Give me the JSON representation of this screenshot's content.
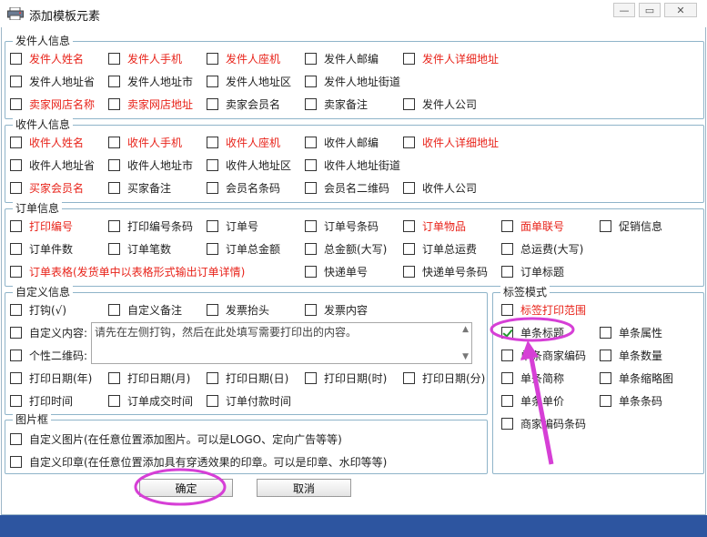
{
  "window": {
    "title": "添加模板元素"
  },
  "sender": {
    "legend": "发件人信息",
    "items": [
      {
        "label": "发件人姓名",
        "red": true
      },
      {
        "label": "发件人手机",
        "red": true
      },
      {
        "label": "发件人座机",
        "red": true
      },
      {
        "label": "发件人邮编",
        "red": false
      },
      {
        "label": "发件人详细地址",
        "red": true
      },
      {
        "label": "发件人地址省",
        "red": false
      },
      {
        "label": "发件人地址市",
        "red": false
      },
      {
        "label": "发件人地址区",
        "red": false
      },
      {
        "label": "发件人地址街道",
        "red": false
      },
      {
        "label": "卖家网店名称",
        "red": true
      },
      {
        "label": "卖家网店地址",
        "red": true
      },
      {
        "label": "卖家会员名",
        "red": false
      },
      {
        "label": "卖家备注",
        "red": false
      },
      {
        "label": "发件人公司",
        "red": false
      }
    ]
  },
  "receiver": {
    "legend": "收件人信息",
    "items": [
      {
        "label": "收件人姓名",
        "red": true
      },
      {
        "label": "收件人手机",
        "red": true
      },
      {
        "label": "收件人座机",
        "red": true
      },
      {
        "label": "收件人邮编",
        "red": false
      },
      {
        "label": "收件人详细地址",
        "red": true
      },
      {
        "label": "收件人地址省",
        "red": false
      },
      {
        "label": "收件人地址市",
        "red": false
      },
      {
        "label": "收件人地址区",
        "red": false
      },
      {
        "label": "收件人地址街道",
        "red": false
      },
      {
        "label": "买家会员名",
        "red": true
      },
      {
        "label": "买家备注",
        "red": false
      },
      {
        "label": "会员名条码",
        "red": false
      },
      {
        "label": "会员名二维码",
        "red": false
      },
      {
        "label": "收件人公司",
        "red": false
      }
    ]
  },
  "order": {
    "legend": "订单信息",
    "items": [
      {
        "label": "打印编号",
        "red": true
      },
      {
        "label": "打印编号条码",
        "red": false
      },
      {
        "label": "订单号",
        "red": false
      },
      {
        "label": "订单号条码",
        "red": false
      },
      {
        "label": "订单物品",
        "red": true
      },
      {
        "label": "面单联号",
        "red": true
      },
      {
        "label": "促销信息",
        "red": false
      },
      {
        "label": "订单件数",
        "red": false
      },
      {
        "label": "订单笔数",
        "red": false
      },
      {
        "label": "订单总金额",
        "red": false
      },
      {
        "label": "总金额(大写)",
        "red": false
      },
      {
        "label": "订单总运费",
        "red": false
      },
      {
        "label": "总运费(大写)",
        "red": false
      },
      {
        "label": "订单表格(发货单中以表格形式输出订单详情)",
        "red": true
      },
      {
        "label": "快递单号",
        "red": false
      },
      {
        "label": "快递单号条码",
        "red": false
      },
      {
        "label": "订单标题",
        "red": false
      }
    ]
  },
  "custom": {
    "legend": "自定义信息",
    "items": [
      {
        "label": "打钩(√)",
        "red": false
      },
      {
        "label": "自定义备注",
        "red": false
      },
      {
        "label": "发票抬头",
        "red": false
      },
      {
        "label": "发票内容",
        "red": false
      },
      {
        "label": "自定义内容:",
        "red": false
      },
      {
        "label": "个性二维码:",
        "red": false
      },
      {
        "label": "打印日期(年)",
        "red": false
      },
      {
        "label": "打印日期(月)",
        "red": false
      },
      {
        "label": "打印日期(日)",
        "red": false
      },
      {
        "label": "打印日期(时)",
        "red": false
      },
      {
        "label": "打印日期(分)",
        "red": false
      },
      {
        "label": "打印时间",
        "red": false
      },
      {
        "label": "订单成交时间",
        "red": false
      },
      {
        "label": "订单付款时间",
        "red": false
      }
    ],
    "textarea_value": "请先在左侧打钩，然后在此处填写需要打印出的内容。"
  },
  "label_mode": {
    "legend": "标签模式",
    "items": [
      {
        "label": "标签打印范围",
        "red": true,
        "checked": false
      },
      {
        "label": "单条标题",
        "red": false,
        "checked": true
      },
      {
        "label": "单条属性",
        "red": false,
        "checked": false
      },
      {
        "label": "单条商家编码",
        "red": false,
        "checked": false
      },
      {
        "label": "单条数量",
        "red": false,
        "checked": false
      },
      {
        "label": "单条简称",
        "red": false,
        "checked": false
      },
      {
        "label": "单条缩略图",
        "red": false,
        "checked": false
      },
      {
        "label": "单条单价",
        "red": false,
        "checked": false
      },
      {
        "label": "单条条码",
        "red": false,
        "checked": false
      },
      {
        "label": "商家编码条码",
        "red": false,
        "checked": false
      }
    ]
  },
  "image_frame": {
    "legend": "图片框",
    "items": [
      {
        "label": "自定义图片(在任意位置添加图片。可以是LOGO、定向广告等等)",
        "red": false
      },
      {
        "label": "自定义印章(在任意位置添加具有穿透效果的印章。可以是印章、水印等等)",
        "red": false
      }
    ]
  },
  "buttons": {
    "ok": "确定",
    "cancel": "取消"
  },
  "colors": {
    "red_label": "#e8231a",
    "annotation": "#d63fd6",
    "bottom_bar": "#2d55a0"
  }
}
